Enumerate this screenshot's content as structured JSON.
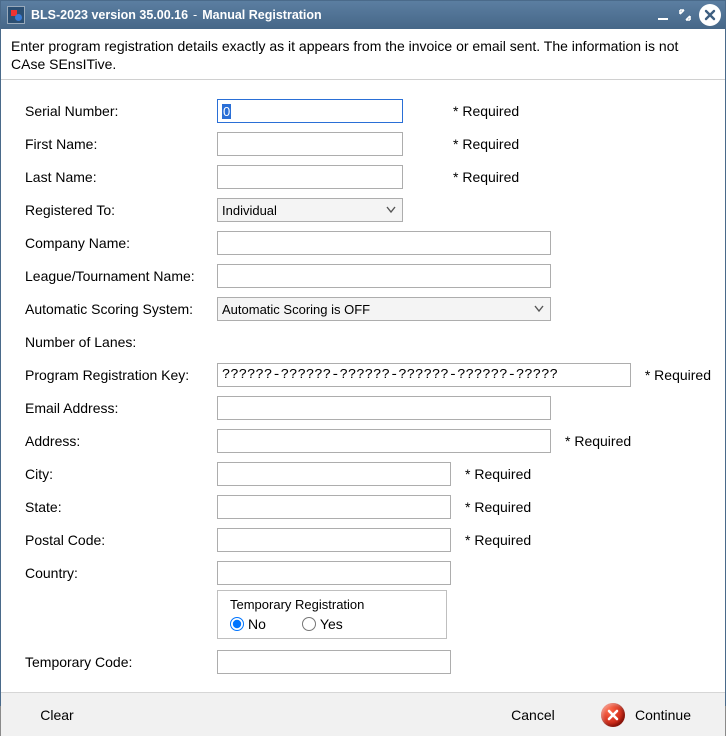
{
  "titlebar": {
    "app_title": "BLS-2023 version 35.00.16",
    "separator": "-",
    "subtitle": "Manual Registration"
  },
  "instructions": "Enter program registration details exactly as it appears from the invoice or email sent. The information is not CAse SEnsITive.",
  "labels": {
    "serial_number": "Serial Number:",
    "first_name": "First Name:",
    "last_name": "Last Name:",
    "registered_to": "Registered To:",
    "company_name": "Company Name:",
    "league_name": "League/Tournament Name:",
    "scoring_system": "Automatic Scoring System:",
    "num_lanes": "Number of Lanes:",
    "reg_key": "Program Registration Key:",
    "email": "Email Address:",
    "address": "Address:",
    "city": "City:",
    "state": "State:",
    "postal": "Postal Code:",
    "country": "Country:",
    "temp_code": "Temporary Code:",
    "required": "* Required"
  },
  "values": {
    "serial_number": "0",
    "first_name": "",
    "last_name": "",
    "registered_to": "Individual",
    "company_name": "",
    "league_name": "",
    "scoring_system": "Automatic Scoring is OFF",
    "num_lanes": "",
    "reg_key": "??????-??????-??????-??????-??????-?????",
    "email": "",
    "address": "",
    "city": "",
    "state": "",
    "postal": "",
    "country": "",
    "temp_code": ""
  },
  "temp_registration": {
    "title": "Temporary Registration",
    "option_no": "No",
    "option_yes": "Yes",
    "selected": "No"
  },
  "buttons": {
    "clear": "Clear",
    "cancel": "Cancel",
    "continue": "Continue"
  }
}
